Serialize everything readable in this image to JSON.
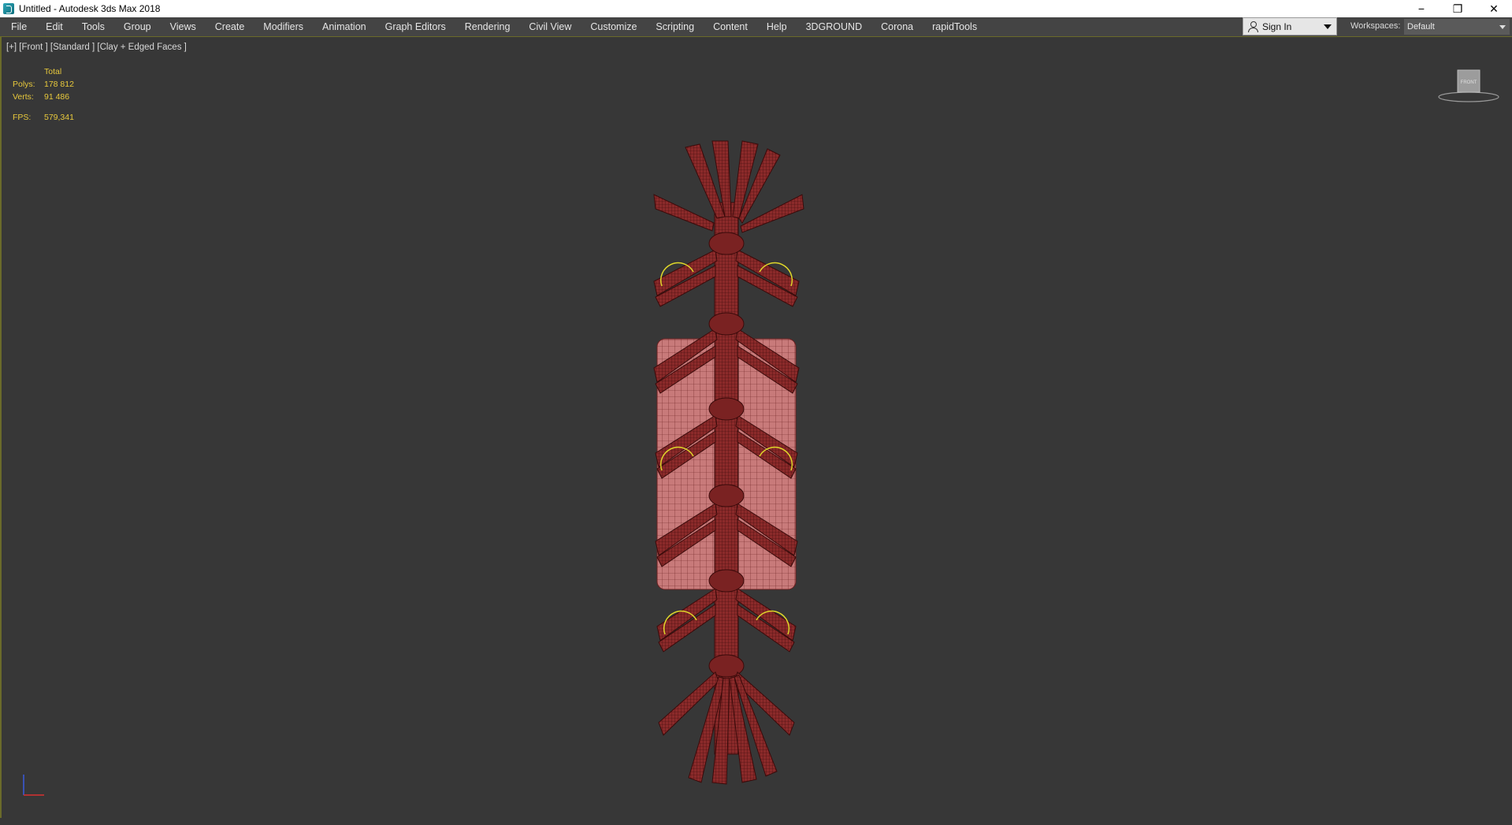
{
  "titlebar": {
    "title": "Untitled - Autodesk 3ds Max 2018",
    "minimize": "−",
    "restore": "❐",
    "close": "✕"
  },
  "menu": {
    "items": [
      {
        "label": "File"
      },
      {
        "label": "Edit"
      },
      {
        "label": "Tools"
      },
      {
        "label": "Group"
      },
      {
        "label": "Views"
      },
      {
        "label": "Create"
      },
      {
        "label": "Modifiers"
      },
      {
        "label": "Animation"
      },
      {
        "label": "Graph Editors"
      },
      {
        "label": "Rendering"
      },
      {
        "label": "Civil View"
      },
      {
        "label": "Customize"
      },
      {
        "label": "Scripting"
      },
      {
        "label": "Content"
      },
      {
        "label": "Help"
      },
      {
        "label": "3DGROUND"
      },
      {
        "label": "Corona"
      },
      {
        "label": "rapidTools"
      }
    ],
    "sign_in": "Sign In",
    "workspaces_label": "Workspaces:",
    "workspace_value": "Default"
  },
  "viewport": {
    "label": "[+] [Front ] [Standard ] [Clay + Edged Faces ]",
    "stats": {
      "header": "Total",
      "polys_label": "Polys:",
      "polys_value": "178 812",
      "verts_label": "Verts:",
      "verts_value": "91 486",
      "fps_label": "FPS:",
      "fps_value": "579,341"
    },
    "navcube_face": "FRONT"
  },
  "colors": {
    "viewport_bg": "#373737",
    "menu_bg": "#444444",
    "stats_text": "#e8c93c",
    "model_fill": "#8b2a2a",
    "model_wire": "#3a0a0a",
    "selection": "#e0d82a"
  }
}
